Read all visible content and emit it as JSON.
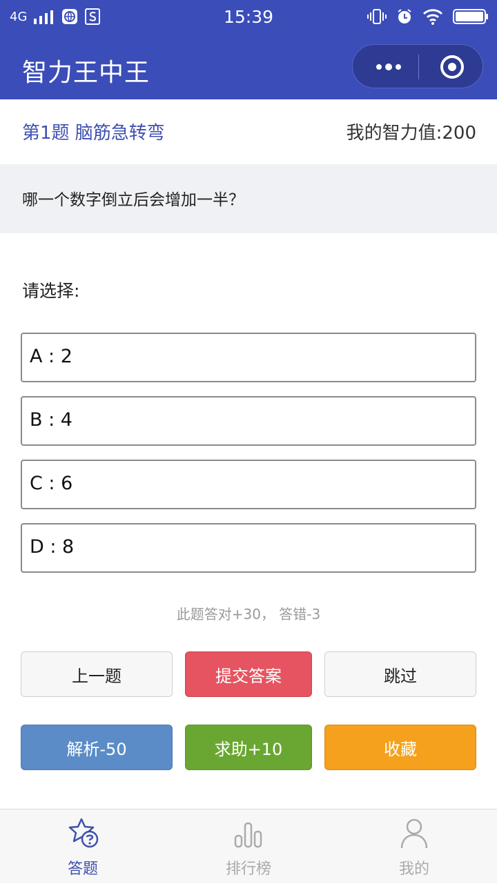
{
  "status_bar": {
    "network": "4G",
    "time": "15:39"
  },
  "nav": {
    "title": "智力王中王"
  },
  "question": {
    "number_title": "第1题 脑筋急转弯",
    "score_label": "我的智力值:200",
    "text": "哪一个数字倒立后会增加一半？",
    "prompt": "请选择:",
    "options": [
      {
        "label": "A : 2"
      },
      {
        "label": "B : 4"
      },
      {
        "label": "C : 6"
      },
      {
        "label": "D : 8"
      }
    ],
    "hint": "此题答对+30， 答错-3"
  },
  "buttons": {
    "prev": "上一题",
    "submit": "提交答案",
    "skip": "跳过",
    "analysis": "解析-50",
    "help": "求助+10",
    "favorite": "收藏"
  },
  "tabbar": {
    "items": [
      {
        "label": "答题",
        "icon": "star-question-icon",
        "active": true
      },
      {
        "label": "排行榜",
        "icon": "bar-chart-icon",
        "active": false
      },
      {
        "label": "我的",
        "icon": "user-icon",
        "active": false
      }
    ]
  },
  "colors": {
    "primary": "#3b4db8",
    "submit": "#e55460",
    "analysis": "#5b8cc8",
    "help": "#6aa732",
    "favorite": "#f5a11d",
    "tab_active": "#3e4fb0",
    "tab_inactive": "#aaaaaa"
  }
}
